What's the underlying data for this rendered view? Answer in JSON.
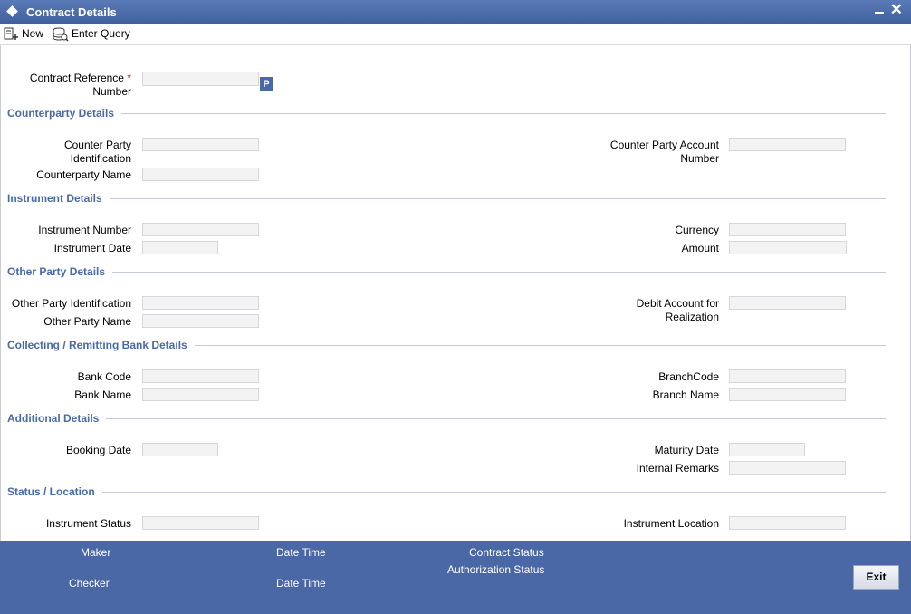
{
  "window": {
    "title": "Contract Details"
  },
  "toolbar": {
    "new_label": "New",
    "enter_query_label": "Enter Query"
  },
  "contract_ref": {
    "label_line1": "Contract Reference",
    "label_line2": "Number",
    "required_mark": "*",
    "lookup_label": "P"
  },
  "sections": {
    "counterparty": {
      "title": "Counterparty Details",
      "cp_id_line1": "Counter Party",
      "cp_id_line2": "Identification",
      "cp_name": "Counterparty Name",
      "cp_account_line1": "Counter Party Account",
      "cp_account_line2": "Number"
    },
    "instrument": {
      "title": "Instrument Details",
      "number": "Instrument Number",
      "date": "Instrument Date",
      "currency": "Currency",
      "amount": "Amount"
    },
    "other_party": {
      "title": "Other Party Details",
      "id": "Other Party Identification",
      "name": "Other Party Name",
      "debit_line1": "Debit Account for",
      "debit_line2": "Realization"
    },
    "bank": {
      "title": "Collecting / Remitting Bank Details",
      "code": "Bank Code",
      "name": "Bank Name",
      "branch_code": "BranchCode",
      "branch_name": "Branch Name"
    },
    "additional": {
      "title": "Additional Details",
      "booking_date": "Booking Date",
      "maturity_date": "Maturity Date",
      "internal_remarks": "Internal Remarks"
    },
    "status": {
      "title": "Status / Location",
      "instrument_status": "Instrument Status",
      "instrument_location": "Instrument Location"
    }
  },
  "footer": {
    "maker": "Maker",
    "checker": "Checker",
    "date_time_1": "Date Time",
    "date_time_2": "Date Time",
    "contract_status": "Contract Status",
    "authorization_status": "Authorization Status",
    "exit_label": "Exit"
  },
  "colors": {
    "accent": "#4a68a6",
    "section_title": "#486aa8",
    "required": "#cc0000"
  }
}
